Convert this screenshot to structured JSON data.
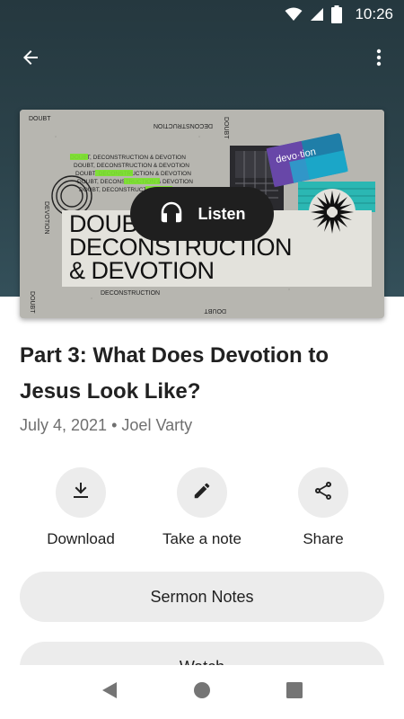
{
  "status_bar": {
    "time": "10:26"
  },
  "artwork": {
    "series_title_lines": [
      "DOUBT,",
      "DECONSTRUCTION",
      "& DEVOTION"
    ],
    "small_lines": [
      "DOUBT, DECONSTRUCTION & DEVOTION",
      "DOUBT, DECONSTRUCTION & DEVOTION",
      "DOUBT, DECONSTRUCTION & DEVOTION",
      "DOUBT, DECONSTRUCTION & DEVOTION",
      "DOUBT, DECONSTRUCTION & DEVOTION"
    ],
    "corner_top_left": "DOUBT",
    "top_center_mirrored": "DECONSTRUCTION",
    "top_right_vertical": "DOUBT",
    "left_vertical": "DEVOTION",
    "bottom_center": "DECONSTRUCTION",
    "bottom_left_vertical": "DOUBT",
    "bottom_right": "DOUBT",
    "sticker_word": "devo·tion",
    "accent_green": "#7be32c"
  },
  "listen": {
    "label": "Listen",
    "icon": "headphones-icon"
  },
  "sermon": {
    "title": "Part 3: What Does Devotion to Jesus Look Like?",
    "date": "July 4, 2021",
    "separator": "•",
    "speaker": "Joel Varty"
  },
  "actions": [
    {
      "label": "Download",
      "icon": "download-icon"
    },
    {
      "label": "Take a note",
      "icon": "pencil-icon"
    },
    {
      "label": "Share",
      "icon": "share-icon"
    }
  ],
  "buttons": {
    "sermon_notes": "Sermon Notes",
    "watch": "Watch"
  }
}
